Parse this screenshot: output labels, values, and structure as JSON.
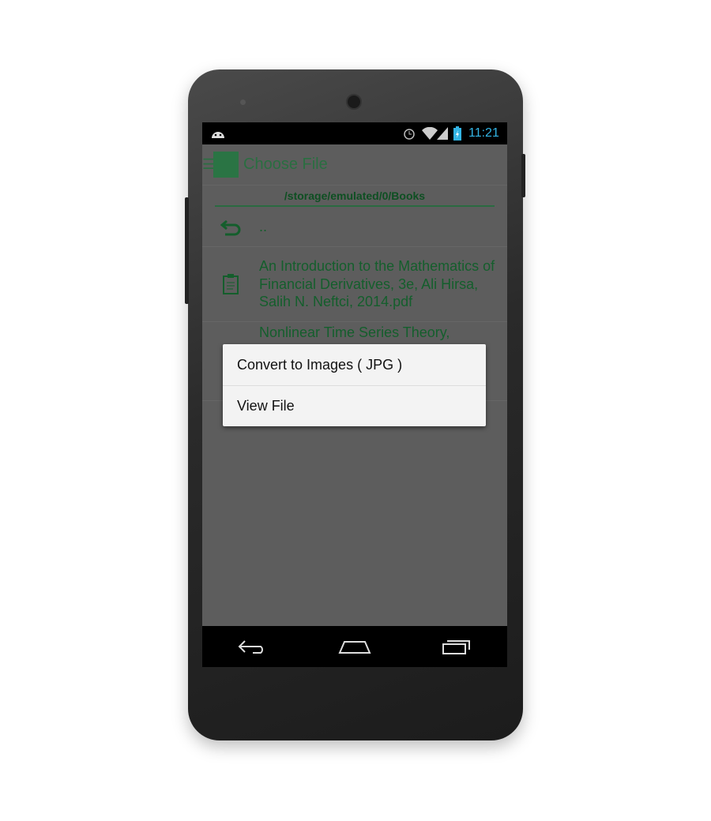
{
  "status_bar": {
    "time": "11:21",
    "icons": [
      "android-icon",
      "alarm-icon",
      "wifi-icon",
      "signal-icon",
      "battery-charging-icon"
    ]
  },
  "app_bar": {
    "title": "Choose File",
    "icons": [
      "menu-icon",
      "app-logo-icon"
    ]
  },
  "path": "/storage/emulated/0/Books",
  "files": [
    {
      "icon": "back-arrow-icon",
      "name": ".."
    },
    {
      "icon": "clipboard-document-icon",
      "name": "An Introduction to the Mathematics of Financial Derivatives, 3e, Ali Hirsa, Salih N. Neftci, 2014.pdf"
    },
    {
      "icon": "clipboard-document-icon",
      "name": "Nonlinear Time Series Theory,"
    }
  ],
  "context_menu": {
    "options": [
      "Convert to Images ( JPG )",
      "View File"
    ]
  },
  "nav_bar": {
    "icons": [
      "back-icon",
      "home-icon",
      "recent-apps-icon"
    ]
  },
  "colors": {
    "accent": "#1e7a3c",
    "status_clock": "#33b5e5"
  }
}
